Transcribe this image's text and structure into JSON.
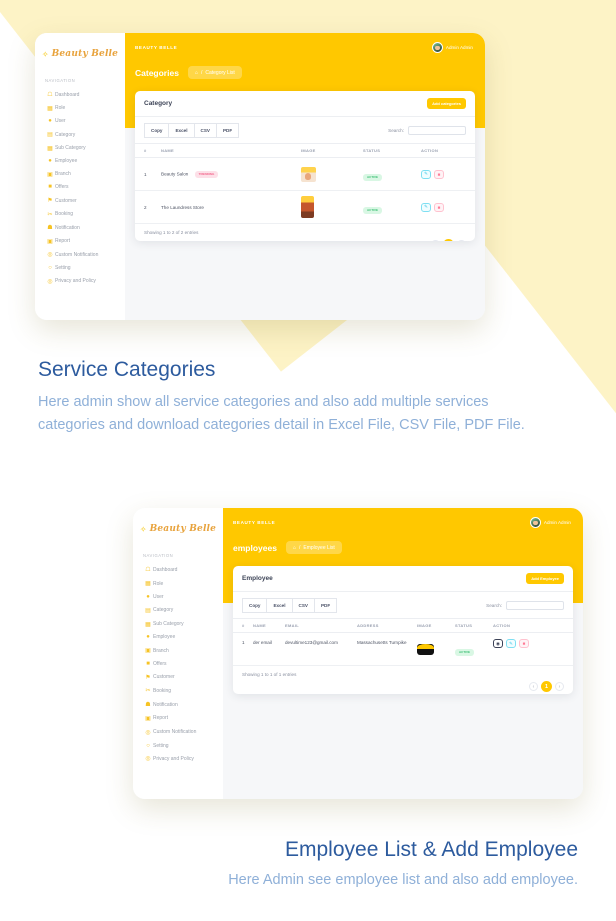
{
  "brand": {
    "mark": "leaf-icon",
    "name": "Beauty Belle"
  },
  "nav": {
    "title": "NAVIGATION",
    "items": [
      {
        "label": "Dashboard",
        "icon": "home-icon"
      },
      {
        "label": "Role",
        "icon": "id-badge-icon"
      },
      {
        "label": "User",
        "icon": "user-icon"
      },
      {
        "label": "Category",
        "icon": "folder-icon"
      },
      {
        "label": "Sub Category",
        "icon": "grid-icon"
      },
      {
        "label": "Employee",
        "icon": "user-tie-icon"
      },
      {
        "label": "Branch",
        "icon": "building-icon"
      },
      {
        "label": "Offers",
        "icon": "gift-icon"
      },
      {
        "label": "Customer",
        "icon": "flag-icon"
      },
      {
        "label": "Booking",
        "icon": "scissors-icon"
      },
      {
        "label": "Notification",
        "icon": "bell-icon"
      },
      {
        "label": "Report",
        "icon": "file-icon"
      },
      {
        "label": "Custom Notification",
        "icon": "bullseye-icon"
      },
      {
        "label": "Setting",
        "icon": "clock-icon"
      },
      {
        "label": "Privacy and Policy",
        "icon": "shield-icon"
      }
    ]
  },
  "card_categories": {
    "topbar": {
      "brand": "BEAUTY BELLE",
      "user_name": "Admin Admin",
      "avatar": "user-avatar"
    },
    "page_title": "Categories",
    "breadcrumb": {
      "home_icon": "home-icon",
      "sep": "/",
      "text": "Category List"
    },
    "panel": {
      "title": "Category",
      "add_button": "Add categories",
      "export_buttons": [
        "Copy",
        "Excel",
        "CSV",
        "PDF"
      ],
      "search_label": "Search:",
      "search_value": "",
      "columns": [
        "#",
        "NAME",
        "IMAGE",
        "STATUS",
        "ACTION"
      ],
      "rows": [
        {
          "num": "1",
          "name": "Beauty Salon",
          "tag": "TRENDING",
          "image": "salon-thumbnail",
          "status": "ACTIVE",
          "actions": [
            "edit-icon",
            "delete-icon"
          ]
        },
        {
          "num": "2",
          "name": "The Laundress Store",
          "tag": "",
          "image": "laundry-thumbnail",
          "status": "ACTIVE",
          "actions": [
            "edit-icon",
            "delete-icon"
          ]
        }
      ],
      "info": "Showing 1 to 2 of 2 entries",
      "pager": {
        "prev": "‹",
        "pages": [
          "1"
        ],
        "next": "›"
      }
    }
  },
  "card_employees": {
    "topbar": {
      "brand": "BEAUTY BELLE",
      "user_name": "Admin Admin",
      "avatar": "user-avatar"
    },
    "page_title": "employees",
    "breadcrumb": {
      "home_icon": "home-icon",
      "sep": "/",
      "text": "Employee List"
    },
    "panel": {
      "title": "Employee",
      "add_button": "Add Employee",
      "export_buttons": [
        "Copy",
        "Excel",
        "CSV",
        "PDF"
      ],
      "search_label": "Search:",
      "search_value": "",
      "columns": [
        "#",
        "NAME",
        "EMAIL",
        "ADDRESS",
        "IMAGE",
        "STATUS",
        "ACTION"
      ],
      "rows": [
        {
          "num": "1",
          "name": "der email",
          "email": "devultime123@gmail.com",
          "address": "Massachusetts Turnpike",
          "image": "employee-thumbnail",
          "status": "ACTIVE",
          "actions": [
            "view-icon",
            "edit-icon",
            "delete-icon"
          ]
        }
      ],
      "info": "Showing 1 to 1 of 1 entries",
      "pager": {
        "prev": "‹",
        "pages": [
          "1"
        ],
        "next": "›"
      }
    }
  },
  "captions": [
    {
      "title": "Service Categories",
      "body": "Here admin show all service categories and also add multiple services categories and download categories detail in Excel File, CSV File, PDF File."
    },
    {
      "title": "Employee List & Add Employee",
      "body": "Here Admin see employee list and also add employee."
    }
  ],
  "colors": {
    "brand_yellow": "#ffc800",
    "pale_yellow": "#fdf3c6",
    "caption_title": "#2d5b9e",
    "caption_body": "#8fb0d8",
    "badge_active": "#3bbf73",
    "badge_trending": "#f2668c"
  }
}
